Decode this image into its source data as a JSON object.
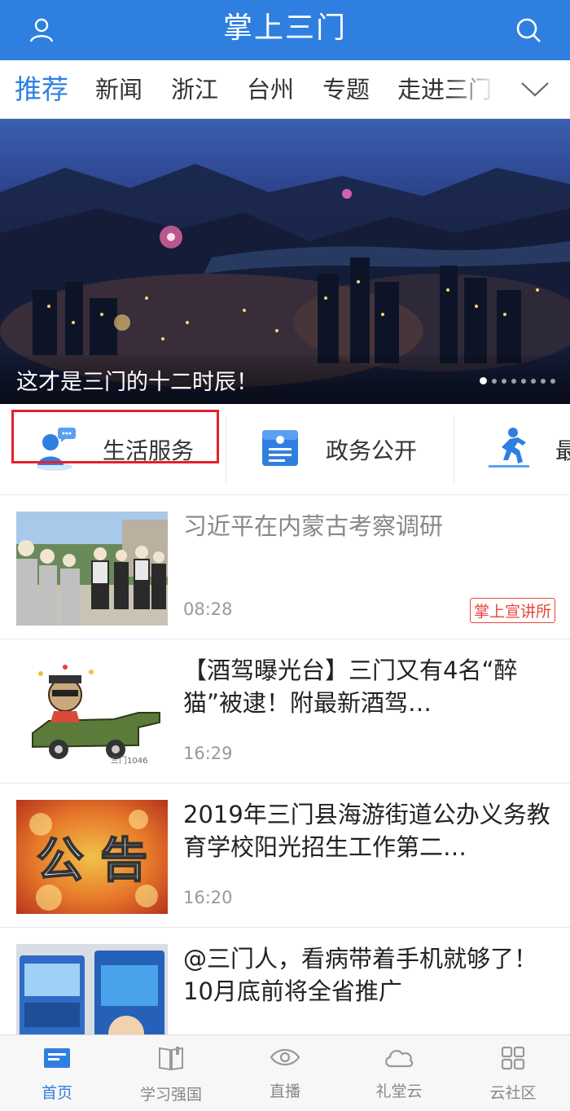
{
  "colors": {
    "brand_blue": "#2f7fe1",
    "highlight_red": "#e6202a",
    "tag_red": "#e8443a"
  },
  "header": {
    "title": "掌上三门",
    "left_icon": "user-icon",
    "right_icon": "search-icon"
  },
  "tabs": [
    {
      "label": "推荐",
      "active": true
    },
    {
      "label": "新闻"
    },
    {
      "label": "浙江"
    },
    {
      "label": "台州"
    },
    {
      "label": "专题"
    },
    {
      "label": "走进三门"
    }
  ],
  "tabs_more_icon": "chevron-down-icon",
  "banner": {
    "caption": "这才是三门的十二时辰！",
    "dots_total": 8,
    "active_dot": 1
  },
  "services": [
    {
      "label": "生活服务",
      "icon": "customer-service-icon",
      "highlighted": true
    },
    {
      "label": "政务公开",
      "icon": "document-icon"
    },
    {
      "label": "最",
      "icon": "runner-icon"
    }
  ],
  "news": [
    {
      "headline": "习近平在内蒙古考察调研",
      "time": "08:28",
      "tag": "掌上宣讲所",
      "read": true,
      "watermark": ""
    },
    {
      "headline": "【酒驾曝光台】三门又有4名“醉猫”被逮！附最新酒驾…",
      "time": "16:29",
      "watermark": "三门1046"
    },
    {
      "headline": "2019年三门县海游街道公办义务教育学校阳光招生工作第二…",
      "time": "16:20",
      "thumb_text": "公 告"
    },
    {
      "headline": "@三门人，看病带着手机就够了！10月底前将全省推广",
      "time": ""
    }
  ],
  "bottom_nav": [
    {
      "label": "首页",
      "icon": "home-news-icon",
      "active": true
    },
    {
      "label": "学习强国",
      "icon": "book-icon"
    },
    {
      "label": "直播",
      "icon": "eye-icon"
    },
    {
      "label": "礼堂云",
      "icon": "cloud-icon"
    },
    {
      "label": "云社区",
      "icon": "grid-icon"
    }
  ]
}
